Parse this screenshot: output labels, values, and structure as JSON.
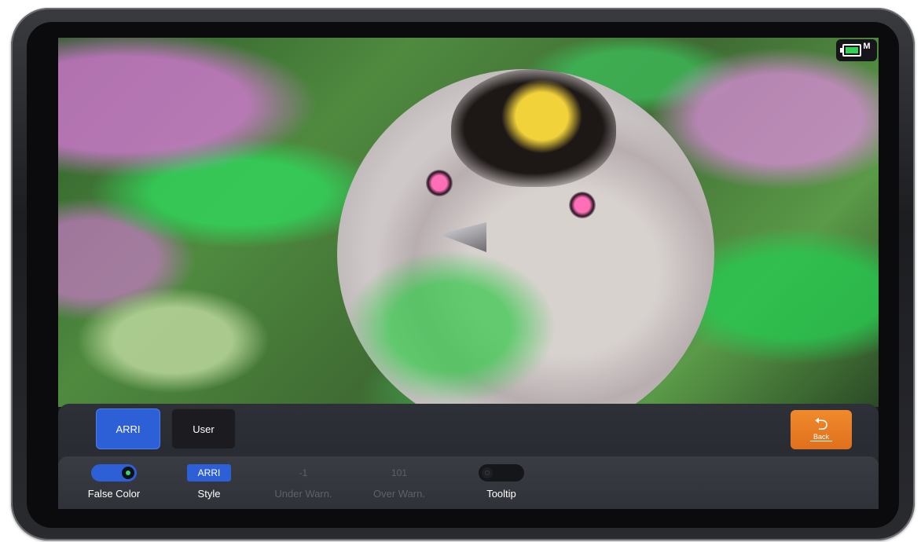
{
  "preset_tabs": [
    {
      "label": "ARRI",
      "selected": true
    },
    {
      "label": "User",
      "selected": false
    }
  ],
  "back_button": {
    "label": "Back",
    "icon": "return-arrow-icon"
  },
  "status": {
    "battery_icon": "battery-icon",
    "mode": "M"
  },
  "controls": {
    "false_color": {
      "label": "False Color",
      "state": "on"
    },
    "style": {
      "label": "Style",
      "value": "ARRI"
    },
    "under_warn": {
      "label": "Under Warn.",
      "value": "-1"
    },
    "over_warn": {
      "label": "Over Warn.",
      "value": "101"
    },
    "tooltip": {
      "label": "Tooltip",
      "state": "off"
    }
  },
  "colors": {
    "accent": "#2d5fd6",
    "back": "#e97c25",
    "indicator": "#3dd07b"
  }
}
